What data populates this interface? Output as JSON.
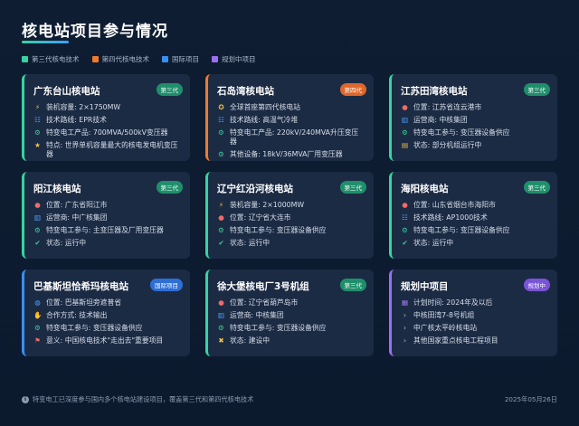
{
  "page": {
    "title": "核电站项目参与情况"
  },
  "legend": [
    {
      "label": "第三代核电技术",
      "color": "#38d39f"
    },
    {
      "label": "第四代核电技术",
      "color": "#f07a2a"
    },
    {
      "label": "国际项目",
      "color": "#3a8ef0"
    },
    {
      "label": "规划中项目",
      "color": "#9a6ff0"
    }
  ],
  "cards": [
    {
      "title": "广东台山核电站",
      "badge": "第三代",
      "rows": [
        {
          "icon": "lightning-icon",
          "text": "装机容量: 2×1750MW"
        },
        {
          "icon": "sliders-icon",
          "text": "技术路线: EPR技术"
        },
        {
          "icon": "gear-icon",
          "text": "特变电工产品: 700MVA/500kV变压器"
        },
        {
          "icon": "star-icon",
          "text": "特点: 世界单机容量最大的核电发电机变压器"
        }
      ]
    },
    {
      "title": "石岛湾核电站",
      "badge": "第四代",
      "rows": [
        {
          "icon": "award-icon",
          "text": "全球首座第四代核电站"
        },
        {
          "icon": "sliders-icon",
          "text": "技术路线: 高温气冷堆"
        },
        {
          "icon": "gear-icon",
          "text": "特变电工产品: 220kV/240MVA升压变压器"
        },
        {
          "icon": "gear-icon",
          "text": "其他设备: 18kV/36MVA厂用变压器"
        }
      ]
    },
    {
      "title": "江苏田湾核电站",
      "badge": "第三代",
      "rows": [
        {
          "icon": "location-icon",
          "text": "位置: 江苏省连云港市"
        },
        {
          "icon": "building-icon",
          "text": "运营商: 中核集团"
        },
        {
          "icon": "gear-icon",
          "text": "特变电工参与: 变压器设备供应"
        },
        {
          "icon": "clipboard-icon",
          "text": "状态: 部分机组运行中"
        }
      ]
    },
    {
      "title": "阳江核电站",
      "badge": "第三代",
      "rows": [
        {
          "icon": "location-icon",
          "text": "位置: 广东省阳江市"
        },
        {
          "icon": "building-icon",
          "text": "运营商: 中广核集团"
        },
        {
          "icon": "gear-icon",
          "text": "特变电工参与: 主变压器及厂用变压器"
        },
        {
          "icon": "check-icon",
          "text": "状态: 运行中"
        }
      ]
    },
    {
      "title": "辽宁红沿河核电站",
      "badge": "第三代",
      "rows": [
        {
          "icon": "lightning-icon",
          "text": "装机容量: 2×1000MW"
        },
        {
          "icon": "location-icon",
          "text": "位置: 辽宁省大连市"
        },
        {
          "icon": "gear-icon",
          "text": "特变电工参与: 变压器设备供应"
        },
        {
          "icon": "check-icon",
          "text": "状态: 运行中"
        }
      ]
    },
    {
      "title": "海阳核电站",
      "badge": "第三代",
      "rows": [
        {
          "icon": "location-icon",
          "text": "位置: 山东省烟台市海阳市"
        },
        {
          "icon": "sliders-icon",
          "text": "技术路线: AP1000技术"
        },
        {
          "icon": "gear-icon",
          "text": "特变电工参与: 变压器设备供应"
        },
        {
          "icon": "check-icon",
          "text": "状态: 运行中"
        }
      ]
    },
    {
      "title": "巴基斯坦恰希玛核电站",
      "badge": "国际项目",
      "rows": [
        {
          "icon": "globe-icon",
          "text": "位置: 巴基斯坦旁遮普省"
        },
        {
          "icon": "handshake-icon",
          "text": "合作方式: 技术输出"
        },
        {
          "icon": "gear-icon",
          "text": "特变电工参与: 变压器设备供应"
        },
        {
          "icon": "flag-icon",
          "text": "意义: 中国核电技术\"走出去\"重要项目"
        }
      ]
    },
    {
      "title": "徐大堡核电厂3号机组",
      "badge": "第三代",
      "rows": [
        {
          "icon": "location-icon",
          "text": "位置: 辽宁省葫芦岛市"
        },
        {
          "icon": "building-icon",
          "text": "运营商: 中核集团"
        },
        {
          "icon": "gear-icon",
          "text": "特变电工参与: 变压器设备供应"
        },
        {
          "icon": "tools-icon",
          "text": "状态: 建设中"
        }
      ]
    },
    {
      "title": "规划中项目",
      "badge": "规划中",
      "rows": [
        {
          "icon": "calendar-icon",
          "text": "计划时间: 2024年及以后"
        },
        {
          "icon": "chevron-right-icon",
          "text": "中核田湾7-8号机组"
        },
        {
          "icon": "chevron-right-icon",
          "text": "中广核太平岭核电站"
        },
        {
          "icon": "chevron-right-icon",
          "text": "其他国家重点核电工程项目"
        }
      ]
    }
  ],
  "footer": {
    "note": "特变电工已深度参与国内多个核电站建设项目，覆盖第三代和第四代核电技术",
    "date": "2025年05月26日"
  }
}
